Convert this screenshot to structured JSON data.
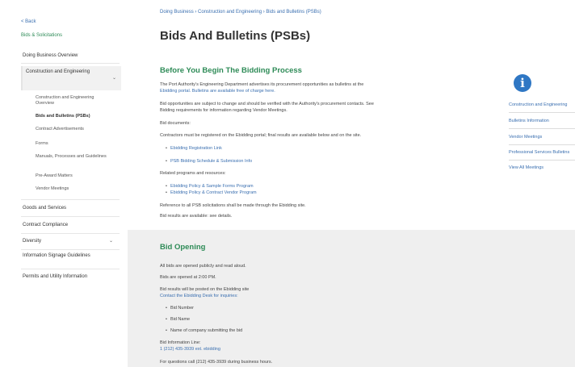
{
  "sidebar": {
    "back": "< Back",
    "section_link": "Bids & Solicitations",
    "items": [
      "Doing Business Overview",
      "Construction and Engineering",
      "Goods and Services",
      "Contract Compliance",
      "Diversity",
      "Information Signage Guidelines",
      "Permits and Utility Information"
    ],
    "subitems": [
      "Construction and Engineering Overview",
      "Bids and Bulletins (PSBs)",
      "Contract Advertisements",
      "Forms",
      "Manuals, Processes and Guidelines",
      "Pre-Award Matters",
      "Vendor Meetings"
    ]
  },
  "breadcrumb": "Doing Business › Construction and Engineering › Bids and Bulletins (PSBs)",
  "page_title": "Bids And Bulletins (PSBs)",
  "before": {
    "heading": "Before You Begin The Bidding Process",
    "p1a": "The Port Authority's Engineering Department advertises its procurement opportunities as bulletins at the",
    "p1b": "Ebidding portal. Bulletins are available free of charge here.",
    "p2a": "Bid opportunities are subject to change and should be verified with the Authority's procurement contacts. See",
    "p2b": "Bidding requirements for information regarding Vendor Meetings.",
    "p3": "Bid documents:",
    "p4": "Contractors must be registered on the Ebidding portal; final results are available below and on the site.",
    "links1": [
      "Ebidding Registration Link",
      "PSB Bidding Schedule & Submission Info"
    ],
    "p5": "Related programs and resources:",
    "links2": [
      "Ebidding Policy & Sample Forms Program",
      "Ebidding Policy & Contract Vendor Program"
    ],
    "p6": "Reference to all PSB solicitations shall be made through the Ebidding site.",
    "p7": "Bid results are available: see details."
  },
  "bid_opening": {
    "heading": "Bid Opening",
    "p1": "All bids are opened publicly and read aloud.",
    "p2": "Bids are opened at 2:00 PM.",
    "p3a": "Bid results will be posted on the Ebidding site",
    "p3b": "Contact the Ebidding Desk for inquiries:",
    "bullets": [
      "Bid Number",
      "Bid Name",
      "Name of company submitting the bid"
    ],
    "p4a": "Bid Information Line:",
    "p4b": "1 (212) 435-3939 ext. ebidding",
    "p5": "For questions call (212) 435-3939 during business hours."
  },
  "side": {
    "links": [
      "Construction and Engineering",
      "Bulletins Information",
      "Vendor Meetings",
      "Professional Services Bulletins",
      "View All Meetings"
    ]
  },
  "colors": {
    "accent_green": "#2e8b57",
    "link_blue": "#3a6fb0",
    "info_blue": "#2f77c4"
  }
}
